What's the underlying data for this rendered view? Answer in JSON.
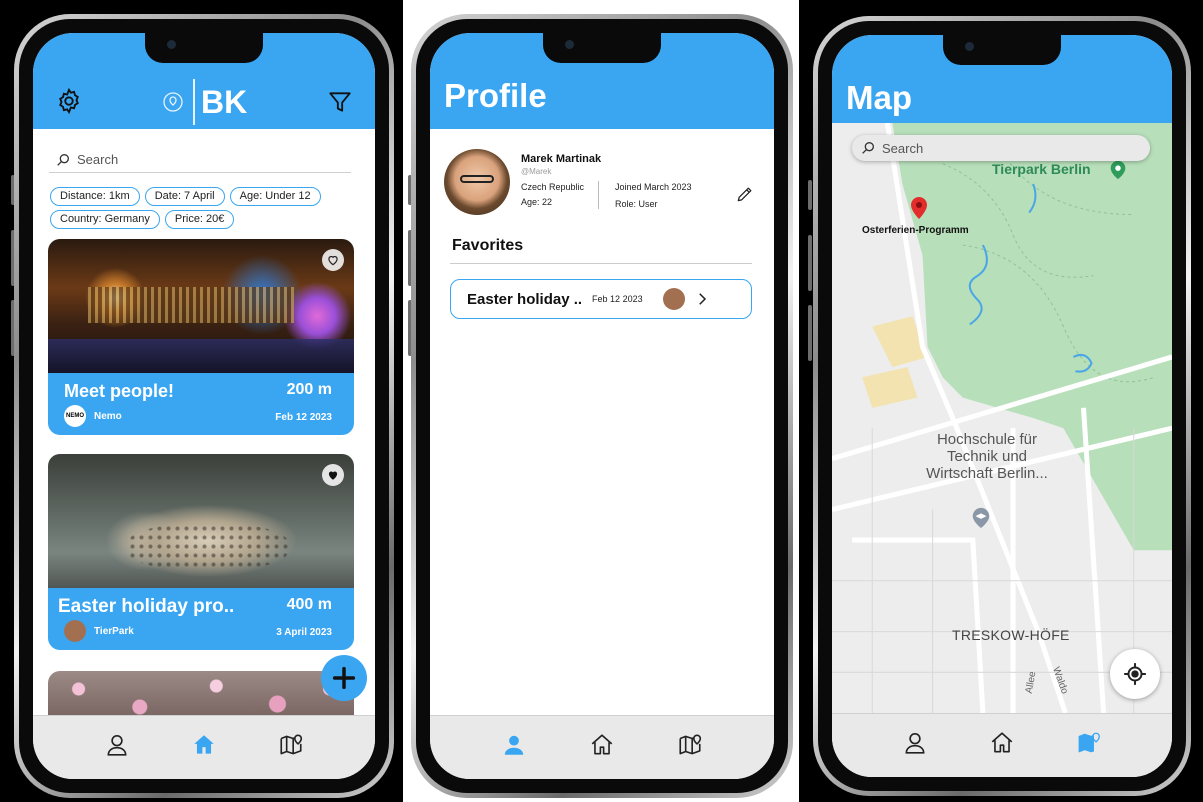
{
  "colors": {
    "accent": "#3aa6f2",
    "tab_active": "#3aa6f2",
    "tab_inactive": "#222222"
  },
  "home": {
    "logo": "BK",
    "search_placeholder": "Search",
    "filters": [
      "Distance: 1km",
      "Date: 7 April",
      "Age: Under 12",
      "Country: Germany",
      "Price: 20€"
    ],
    "events": [
      {
        "title": "Meet people!",
        "distance": "200 m",
        "organizer": "Nemo",
        "date": "Feb 12 2023",
        "favorited": false,
        "org_badge": "NEMO"
      },
      {
        "title": "Easter holiday pro..",
        "distance": "400 m",
        "organizer": "TierPark",
        "date": "3 April 2023",
        "favorited": true
      }
    ],
    "active_tab": "home"
  },
  "profile": {
    "title": "Profile",
    "name": "Marek Martinak",
    "handle": "@Marek",
    "country": "Czech Republic",
    "age": "Age: 22",
    "joined": "Joined March 2023",
    "role": "Role: User",
    "favorites_title": "Favorites",
    "favorites": [
      {
        "title": "Easter holiday ..",
        "date": "Feb 12 2023"
      }
    ],
    "active_tab": "profile"
  },
  "map": {
    "title": "Map",
    "search_placeholder": "Search",
    "pin_label": "Osterferien-Programm",
    "places": {
      "park": "Tierpark Berlin",
      "school": "Hochschule für Technik und Wirtschaft Berlin...",
      "district": "TRESKOW-HÖFE",
      "street1": "Allee",
      "street2": "Waldo"
    },
    "active_tab": "map"
  }
}
